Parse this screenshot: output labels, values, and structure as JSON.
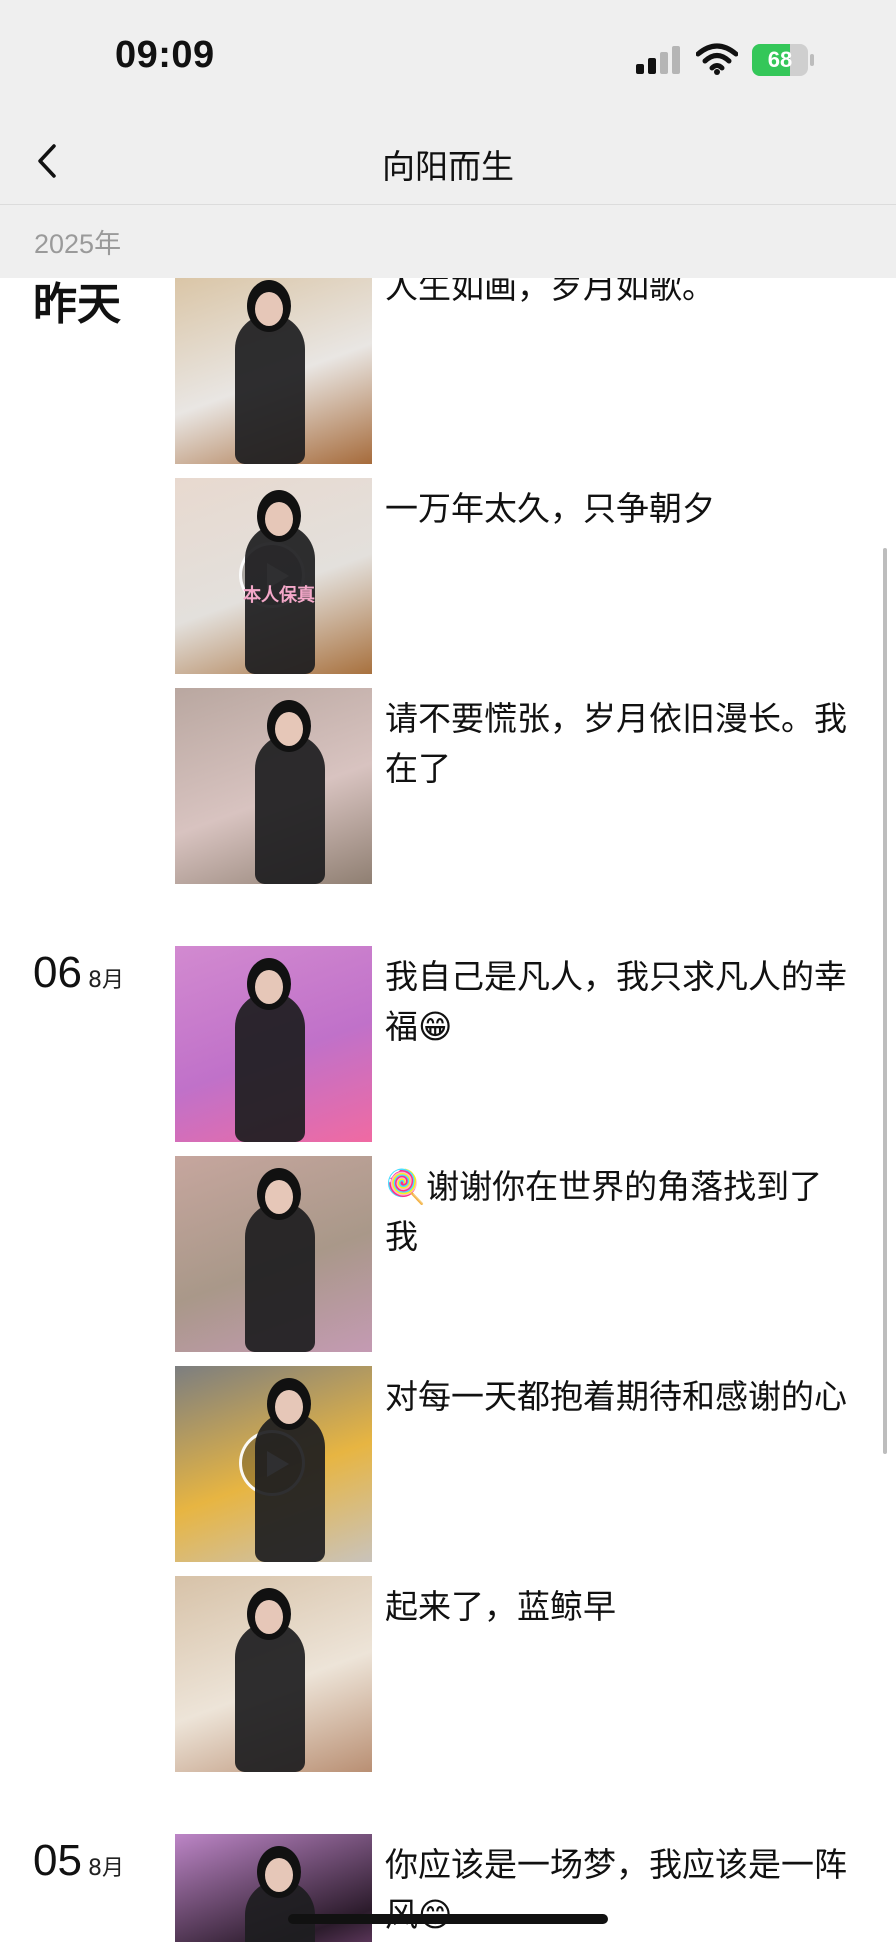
{
  "status_bar": {
    "time": "09:09",
    "battery_level": "68",
    "battery_fraction": 0.68,
    "battery_color": "#34c759",
    "icons": [
      "signal-icon",
      "wifi-icon",
      "battery-icon"
    ]
  },
  "nav": {
    "back_icon": "chevron-left-icon",
    "title": "向阳而生"
  },
  "year_label": "2025年",
  "days": [
    {
      "label": "昨天",
      "month": "",
      "posts": [
        {
          "text": "人生如画，岁月如歌。",
          "has_video": false,
          "palette": [
            "#d9c3a2",
            "#a66b3b",
            "#e9e6e3"
          ]
        },
        {
          "text": "一万年太久，只争朝夕",
          "has_video": true,
          "overlay_text": "本人保真",
          "palette": [
            "#e8d9cf",
            "#a8713e",
            "#e3e0dc"
          ]
        },
        {
          "text": "请不要慌张，岁月依旧漫长。我在了",
          "has_video": false,
          "palette": [
            "#b9a7a0",
            "#8f7f72",
            "#d8c3c0"
          ]
        }
      ]
    },
    {
      "label": "06",
      "month": "8月",
      "posts": [
        {
          "text": "我自己是凡人，我只求凡人的幸福😁",
          "has_video": false,
          "palette": [
            "#d28ad0",
            "#f06aa2",
            "#c071c9"
          ]
        },
        {
          "text": "🍭谢谢你在世界的角落找到了我",
          "has_video": false,
          "palette": [
            "#c6a69e",
            "#c49ab3",
            "#a99889"
          ]
        },
        {
          "text": "对每一天都抱着期待和感谢的心",
          "has_video": true,
          "palette": [
            "#7c7e80",
            "#c9c3bb",
            "#e7b542"
          ]
        },
        {
          "text": "起来了，蓝鲸早",
          "has_video": false,
          "palette": [
            "#d7c2a8",
            "#b98f73",
            "#ede4d8"
          ]
        }
      ]
    },
    {
      "label": "05",
      "month": "8月",
      "posts": [
        {
          "text": "你应该是一场梦，我应该是一阵风😁",
          "has_video": false,
          "palette": [
            "#bd86c7",
            "#d67bd1",
            "#2b1b2b"
          ]
        }
      ]
    }
  ]
}
